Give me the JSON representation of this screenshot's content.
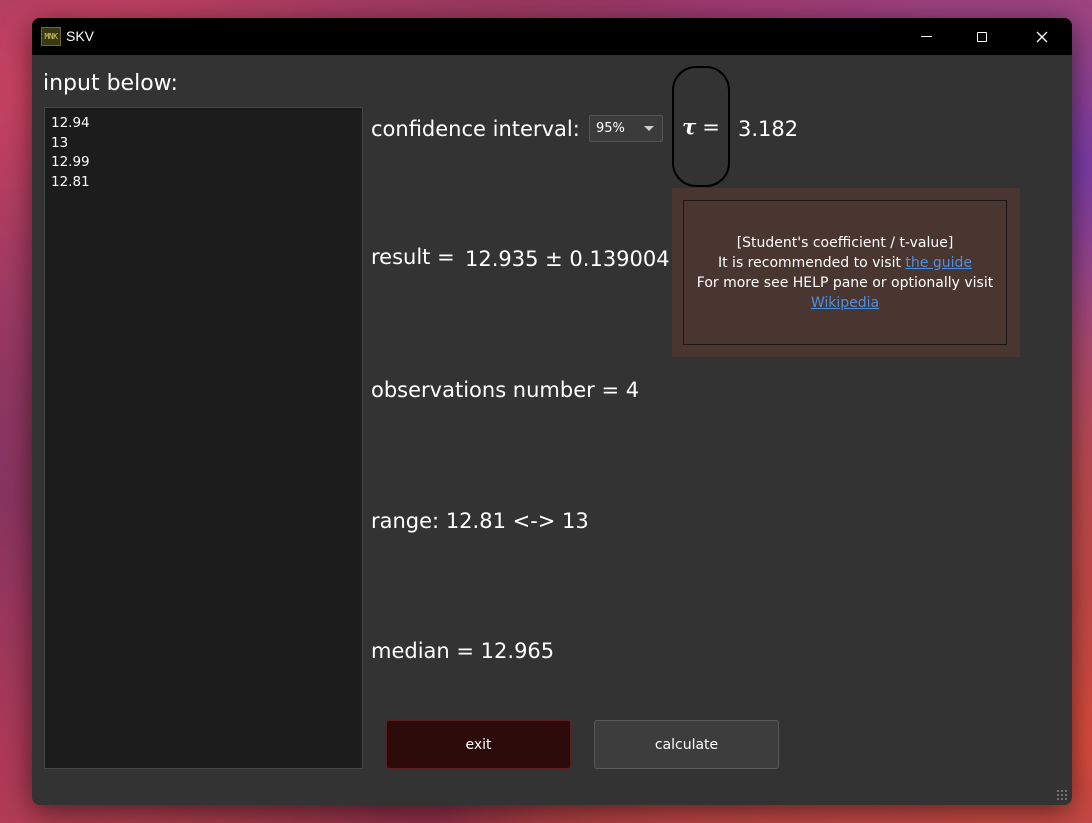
{
  "window": {
    "title": "SKV",
    "icon_text": "MNK",
    "controls": {
      "minimize": "minimize",
      "maximize": "maximize",
      "close": "×"
    }
  },
  "input": {
    "label": "input below:",
    "lines": [
      "12.94",
      "13",
      "12.99",
      "12.81"
    ]
  },
  "confidence": {
    "label": "confidence interval:",
    "selected": "95%"
  },
  "tau": {
    "symbol": "τ",
    "equals": "=",
    "value": "3.182"
  },
  "tooltip": {
    "line1": "[Student's coefficient / t-value]",
    "line2_prefix": "It is recommended to visit ",
    "line2_link": "the guide",
    "line3": "For more see HELP pane or optionally visit",
    "line4_link": "Wikipedia"
  },
  "result": {
    "label": "result =",
    "value": "12.935 ± 0.139004"
  },
  "observations": {
    "text": "observations number = 4"
  },
  "range": {
    "text": "range:  12.81 <-> 13"
  },
  "median": {
    "text": "median =  12.965"
  },
  "buttons": {
    "exit": "exit",
    "calculate": "calculate"
  },
  "colors": {
    "window_bg": "#333333",
    "titlebar_bg": "#000000",
    "input_bg": "#1c1c1c",
    "tooltip_bg": "#4a3630",
    "link": "#4d8fe0",
    "exit_bg": "#2e0b0b",
    "calculate_bg": "#3d3d3d"
  }
}
